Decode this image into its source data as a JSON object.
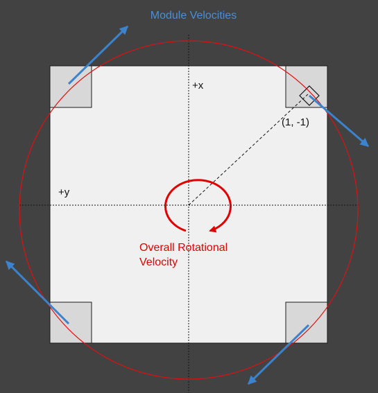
{
  "diagram": {
    "title": "Module Velocities",
    "axis_x_label": "+x",
    "axis_y_label": "+y",
    "module_coordinate_label": "(1, -1)",
    "rotation_label_line1": "Overall Rotational",
    "rotation_label_line2": "Velocity"
  },
  "colors": {
    "background": "#424242",
    "robot_body": "#f0f0f0",
    "module_fill": "#d8d8d8",
    "outline": "#1a1a1a",
    "circle": "#e01010",
    "rotation_arrow": "#e00000",
    "velocity_arrow": "#3b83cc",
    "title_text": "#4a8fd6"
  }
}
